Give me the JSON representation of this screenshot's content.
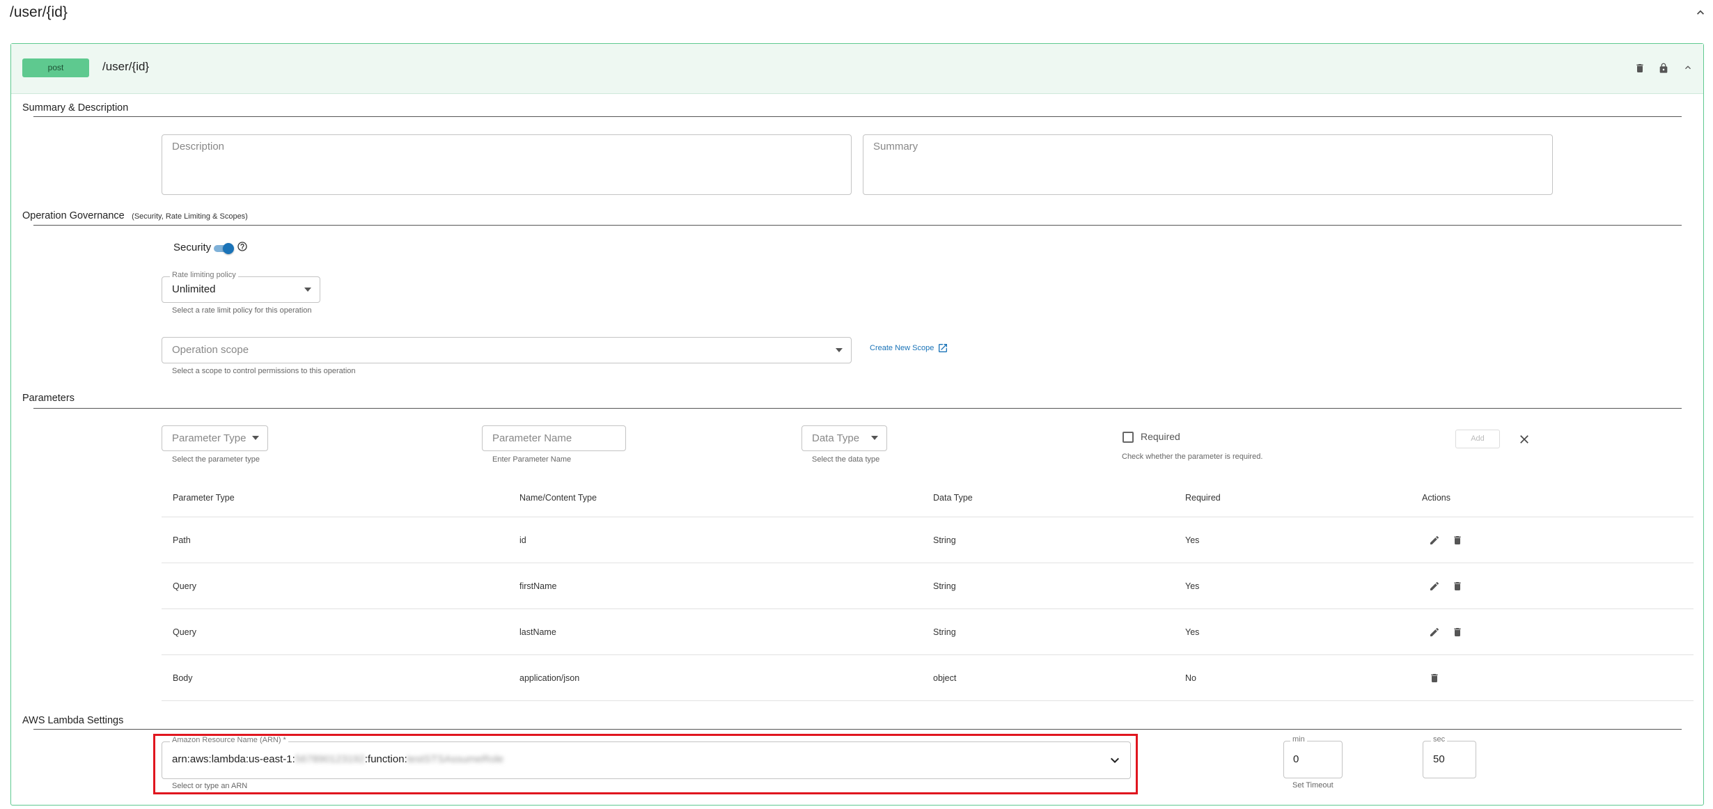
{
  "resource": {
    "path": "/user/{id}"
  },
  "operation": {
    "method": "post",
    "path": "/user/{id}"
  },
  "sections": {
    "summary": "Summary & Description",
    "governance": "Operation Governance",
    "governance_sub": "(Security, Rate Limiting & Scopes)",
    "parameters": "Parameters",
    "lambda": "AWS Lambda Settings"
  },
  "summary_fields": {
    "description_placeholder": "Description",
    "summary_placeholder": "Summary"
  },
  "governance": {
    "security_label": "Security",
    "security_enabled": true,
    "rate_label": "Rate limiting policy",
    "rate_value": "Unlimited",
    "rate_helper": "Select a rate limit policy for this operation",
    "scope_placeholder": "Operation scope",
    "scope_helper": "Select a scope to control permissions to this operation",
    "create_scope": "Create New Scope"
  },
  "param_form": {
    "type_placeholder": "Parameter Type",
    "type_helper": "Select the parameter type",
    "name_placeholder": "Parameter Name",
    "name_helper": "Enter Parameter Name",
    "datatype_placeholder": "Data Type",
    "datatype_helper": "Select the data type",
    "required_label": "Required",
    "required_helper": "Check whether the parameter is required.",
    "add_label": "Add"
  },
  "param_table": {
    "headers": [
      "Parameter Type",
      "Name/Content Type",
      "Data Type",
      "Required",
      "Actions"
    ],
    "rows": [
      {
        "type": "Path",
        "name": "id",
        "datatype": "String",
        "required": "Yes",
        "editable": true
      },
      {
        "type": "Query",
        "name": "firstName",
        "datatype": "String",
        "required": "Yes",
        "editable": true
      },
      {
        "type": "Query",
        "name": "lastName",
        "datatype": "String",
        "required": "Yes",
        "editable": true
      },
      {
        "type": "Body",
        "name": "application/json",
        "datatype": "object",
        "required": "No",
        "editable": false
      }
    ]
  },
  "lambda": {
    "arn_label": "Amazon Resource Name (ARN) *",
    "arn_prefix": "arn:aws:lambda:us-east-1:",
    "arn_account": "567890123192",
    "arn_mid": ":function:",
    "arn_function": "testSTSAssumeRole",
    "arn_helper": "Select or type an ARN",
    "min_label": "min",
    "min_value": "0",
    "sec_label": "sec",
    "sec_value": "50",
    "timeout_helper": "Set Timeout"
  },
  "colors": {
    "accent": "#1a73b8",
    "post_badge": "#5ec98f",
    "operation_bg": "#eef8f2",
    "operation_border": "#5ec98f",
    "highlight": "#e0161f"
  }
}
